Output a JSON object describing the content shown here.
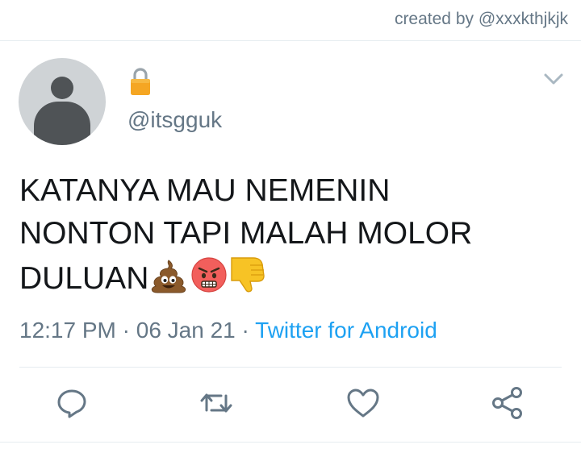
{
  "credit": "created by @xxxkthjkjk",
  "user": {
    "handle": "@itsgguk"
  },
  "tweet": {
    "line1": "KATANYA MAU NEMENIN",
    "line2": "NONTON TAPI MALAH MOLOR",
    "line3": "DULUAN",
    "emojis": [
      "poop-emoji",
      "angry-face-emoji",
      "thumbs-down-emoji"
    ]
  },
  "meta": {
    "time": "12:17 PM",
    "sep1": " · ",
    "date": "06 Jan 21",
    "sep2": " · ",
    "source": "Twitter for Android"
  },
  "actions": [
    "reply-icon",
    "retweet-icon",
    "like-icon",
    "share-icon"
  ],
  "colors": {
    "link": "#1da1f2",
    "muted": "#657786",
    "text": "#14171a",
    "icon": "#657786"
  }
}
